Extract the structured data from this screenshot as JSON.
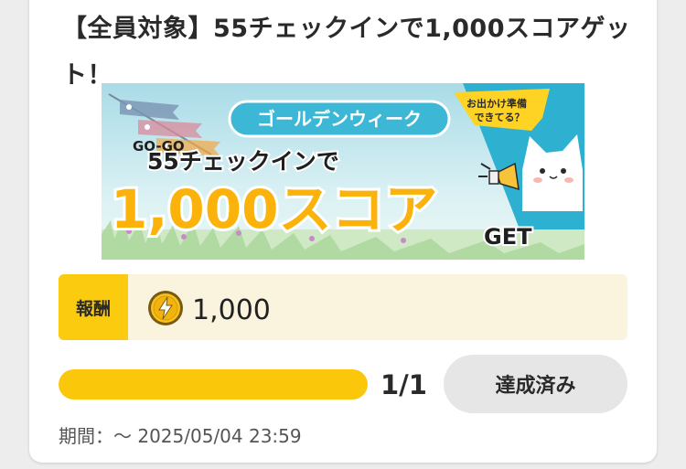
{
  "card": {
    "title": "【全員対象】55チェックインで1,000スコアゲット！"
  },
  "banner": {
    "badge_text": "ゴールデンウィーク",
    "bubble_line1": "お出かけ準備",
    "bubble_line2": "できてる？",
    "gogo_text": "GO-GO",
    "checkin_text": "55チェックインで",
    "score_text": "1,000スコア",
    "get_text": "GET",
    "colors": {
      "sky": "#bfe6ee",
      "accent": "#fbb20a",
      "badge": "#3cb7d6",
      "bubble": "#ffd324"
    }
  },
  "reward": {
    "label": "報酬",
    "coin_icon": "lightning-coin-icon",
    "value": "1,000"
  },
  "progress": {
    "fraction": 1.0,
    "count_text": "1/1"
  },
  "action": {
    "button_label": "達成済み"
  },
  "period": {
    "text": "期間：〜 2025/05/04 23:59"
  },
  "colors": {
    "brand_yellow": "#fbc70b",
    "reward_bg": "#faf3de",
    "button_bg": "#e6e6e6"
  }
}
